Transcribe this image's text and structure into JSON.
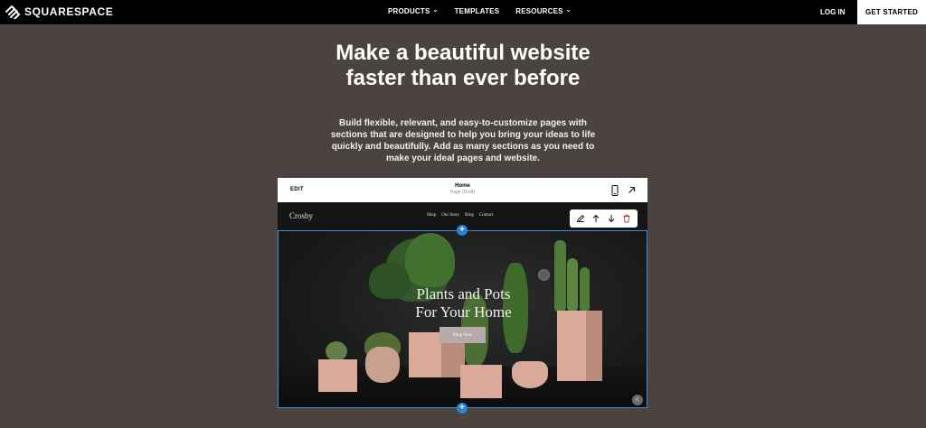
{
  "header": {
    "brand": "SQUARESPACE",
    "nav": [
      {
        "label": "PRODUCTS",
        "has_menu": true
      },
      {
        "label": "TEMPLATES",
        "has_menu": false
      },
      {
        "label": "RESOURCES",
        "has_menu": true
      }
    ],
    "login": "LOG IN",
    "cta": "GET STARTED"
  },
  "hero": {
    "headline": "Make a beautiful website faster than ever before",
    "subcopy": "Build flexible, relevant, and easy-to-customize pages with sections that are designed to help you bring your ideas to life quickly and beautifully. Add as many sections as you need to make your ideal pages and website."
  },
  "editor": {
    "edit_label": "EDIT",
    "page_title": "Home",
    "page_status": "Page (Draft)",
    "site": {
      "logo": "Crosby",
      "nav": [
        "Shop",
        "Our Story",
        "Blog",
        "Contact"
      ]
    },
    "section_toolbar": [
      "pencil-icon",
      "arrow-up-icon",
      "arrow-down-icon",
      "trash-icon"
    ],
    "banner": {
      "title_line1": "Plants and Pots",
      "title_line2": "For Your Home",
      "button": "Shop Now"
    },
    "add_button": "+"
  },
  "colors": {
    "page_bg": "#4a4340",
    "nav_bg": "#000000",
    "selection_blue": "#2a82d6",
    "pot": "#d9aa99"
  }
}
